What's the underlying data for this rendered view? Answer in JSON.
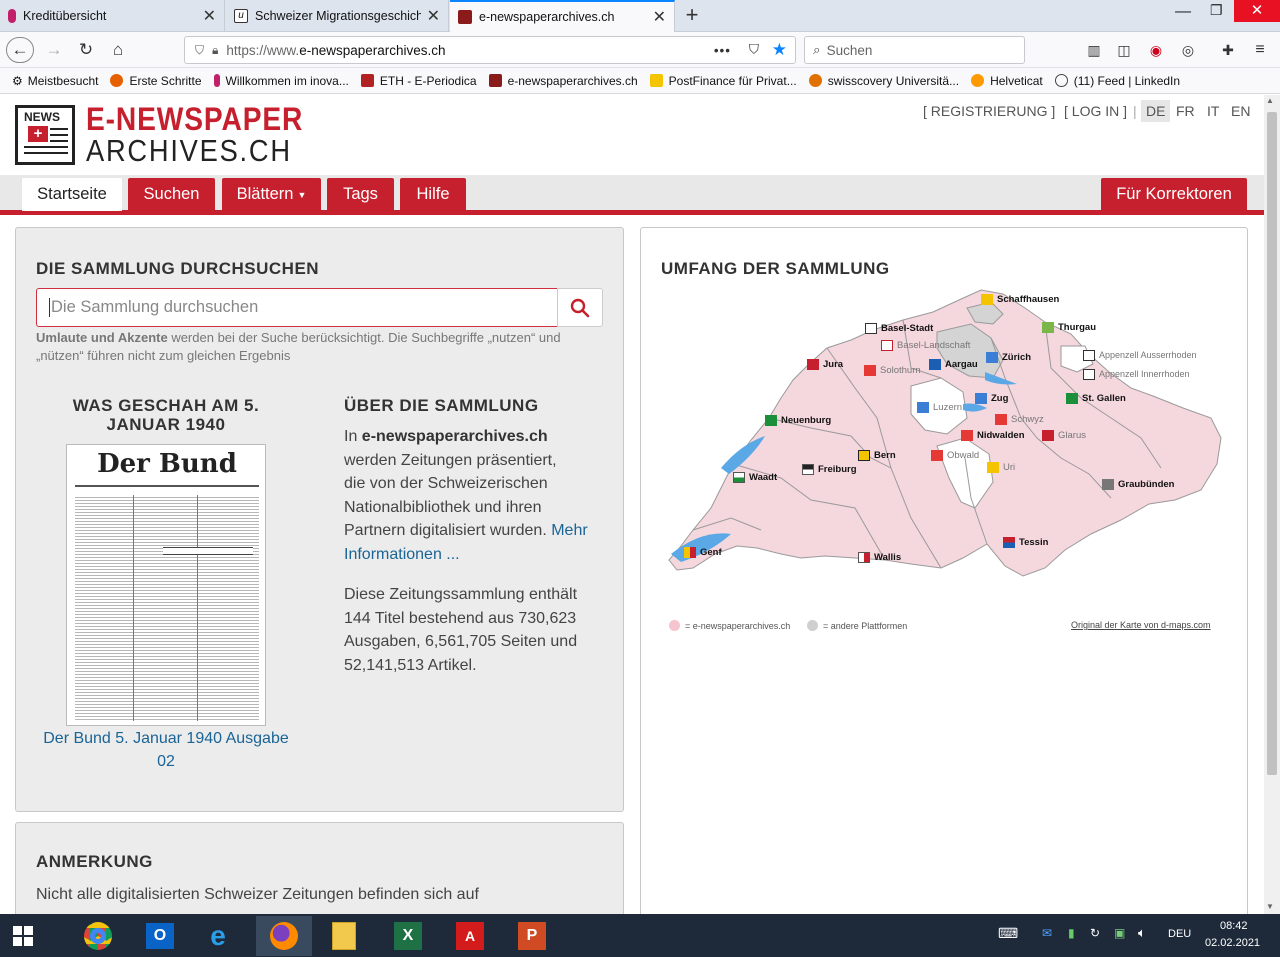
{
  "browser": {
    "tabs": [
      {
        "title": "Kreditübersicht",
        "favicon_color": "#c21f6b"
      },
      {
        "title": "Schweizer Migrationsgeschicht",
        "favicon_color": "#333333"
      },
      {
        "title": "e-newspaperarchives.ch",
        "favicon_color": "#8b1a1a",
        "active": true
      }
    ],
    "new_tab_symbol": "+",
    "url_prefix": "https://www.",
    "url_domain": "e-newspaperarchives.ch",
    "search_placeholder": "Suchen",
    "page_actions_symbol": "•••",
    "bookmarks": [
      {
        "label": "Meistbesucht",
        "icon": "gear-icon"
      },
      {
        "label": "Erste Schritte",
        "favicon_color": "#e66000"
      },
      {
        "label": "Willkommen im inova...",
        "favicon_color": "#c21f6b"
      },
      {
        "label": "ETH - E-Periodica",
        "favicon_color": "#b22222"
      },
      {
        "label": "e-newspaperarchives.ch",
        "favicon_color": "#8b1a1a"
      },
      {
        "label": "PostFinance für Privat...",
        "favicon_color": "#f5c400"
      },
      {
        "label": "swisscovery Universitä...",
        "favicon_color": "#e07000"
      },
      {
        "label": "Helveticat",
        "favicon_color": "#ff9900"
      },
      {
        "label": "(11) Feed | LinkedIn",
        "favicon_color": "#444444"
      }
    ]
  },
  "site": {
    "logo_badge": "NEWS",
    "logo_line1": "E-NEWSPAPER",
    "logo_line2": "ARCHIVES.CH",
    "top_links": {
      "register": "[ REGISTRIERUNG ]",
      "login": "[ LOG IN ]",
      "separator": "|"
    },
    "languages": [
      "DE",
      "FR",
      "IT",
      "EN"
    ],
    "active_language": "DE",
    "nav": {
      "home": "Startseite",
      "search": "Suchen",
      "browse": "Blättern",
      "tags": "Tags",
      "help": "Hilfe",
      "correctors": "Für Korrektoren"
    },
    "brand_color": "#c6202e"
  },
  "search_panel": {
    "title": "DIE SAMMLUNG DURCHSUCHEN",
    "placeholder": "Die Sammlung durchsuchen",
    "hint_bold": "Umlaute und Akzente",
    "hint_rest_line1": " werden bei der Suche berücksichtigt. Die Suchbegriffe „nutzen“ und",
    "hint_line2": "„nützen“ führen nicht zum gleichen Ergebnis"
  },
  "history": {
    "title_line1": "WAS GESCHAH AM 5.",
    "title_line2": "JANUAR 1940",
    "newspaper_masthead": "Der Bund",
    "link_line1": "Der Bund 5. Januar 1940 Ausgabe",
    "link_line2": "02"
  },
  "about": {
    "title": "ÜBER DIE SAMMLUNG",
    "p1_pre": "In ",
    "p1_bold": "e-newspaperarchives.ch",
    "p1_line2": "werden Zeitungen präsentiert,",
    "p1_line3": "die von der Schweizerischen",
    "p1_line4": "Nationalbibliothek und ihren",
    "p1_line5_text": "Partnern digitalisiert wurden. ",
    "p1_line5_link": "Mehr",
    "p1_line6_link": "Informationen ...",
    "p2_line1": "Diese Zeitungssammlung enthält",
    "p2_line2": "144 Titel bestehend aus 730,623",
    "p2_line3": "Ausgaben, 6,561,705 Seiten und",
    "p2_line4": "52,141,513 Artikel."
  },
  "note": {
    "title": "ANMERKUNG",
    "line1": "Nicht alle digitalisierten Schweizer Zeitungen befinden sich auf"
  },
  "map": {
    "title": "UMFANG DER SAMMLUNG",
    "legend_pink": "= e-newspaperarchives.ch",
    "legend_grey": "= andere Plattformen",
    "credit": "Original der Karte von d-maps.com",
    "pink_color": "#f5d7de",
    "grey_color": "#d4d4d4",
    "cantons": [
      {
        "name": "Schaffhausen",
        "bold": true
      },
      {
        "name": "Basel-Stadt",
        "bold": true
      },
      {
        "name": "Thurgau",
        "bold": true
      },
      {
        "name": "Basel-Landschaft",
        "bold": false
      },
      {
        "name": "Jura",
        "bold": true
      },
      {
        "name": "Solothurn",
        "bold": false
      },
      {
        "name": "Aargau",
        "bold": true
      },
      {
        "name": "Zürich",
        "bold": true
      },
      {
        "name": "Appenzell Ausserrhoden",
        "bold": false
      },
      {
        "name": "Appenzell Innerrhoden",
        "bold": false
      },
      {
        "name": "Zug",
        "bold": true
      },
      {
        "name": "St. Gallen",
        "bold": true
      },
      {
        "name": "Luzern",
        "bold": false
      },
      {
        "name": "Schwyz",
        "bold": false
      },
      {
        "name": "Neuenburg",
        "bold": true
      },
      {
        "name": "Nidwalden",
        "bold": true
      },
      {
        "name": "Glarus",
        "bold": false
      },
      {
        "name": "Bern",
        "bold": true
      },
      {
        "name": "Obwald",
        "bold": false
      },
      {
        "name": "Freiburg",
        "bold": true
      },
      {
        "name": "Uri",
        "bold": false
      },
      {
        "name": "Waadt",
        "bold": true
      },
      {
        "name": "Graubünden",
        "bold": true
      },
      {
        "name": "Tessin",
        "bold": true
      },
      {
        "name": "Genf",
        "bold": true
      },
      {
        "name": "Wallis",
        "bold": true
      }
    ]
  },
  "taskbar": {
    "language": "DEU",
    "time": "08:42",
    "date": "02.02.2021"
  }
}
